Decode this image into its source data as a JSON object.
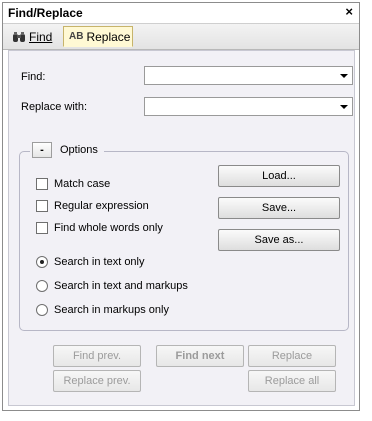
{
  "window": {
    "title": "Find/Replace",
    "close_glyph": "×"
  },
  "tabs": [
    {
      "label": "Find",
      "icon": "binoculars-icon",
      "active": false
    },
    {
      "label": "Replace",
      "icon": "replace-icon",
      "icon_text": "AB",
      "active": true
    }
  ],
  "fields": {
    "find_label": "Find:",
    "find_value": "",
    "replace_label": "Replace with:",
    "replace_value": ""
  },
  "options": {
    "collapse_glyph": "-",
    "title": "Options",
    "checkboxes": [
      {
        "label": "Match case",
        "checked": false
      },
      {
        "label": "Regular expression",
        "checked": false
      },
      {
        "label": "Find whole words only",
        "checked": false
      }
    ],
    "radios": [
      {
        "label": "Search in text only",
        "selected": true
      },
      {
        "label": "Search in text and markups",
        "selected": false
      },
      {
        "label": "Search in markups only",
        "selected": false
      }
    ],
    "buttons": {
      "load": "Load...",
      "save": "Save...",
      "save_as": "Save as..."
    }
  },
  "actions": {
    "find_prev": "Find prev.",
    "find_next": "Find next",
    "replace": "Replace",
    "replace_prev": "Replace prev.",
    "replace_all": "Replace all"
  },
  "colors": {
    "active_tab_bg": "#fff9d4",
    "panel_bg": "#f2f1f6",
    "disabled_text": "#9b9b9b"
  }
}
